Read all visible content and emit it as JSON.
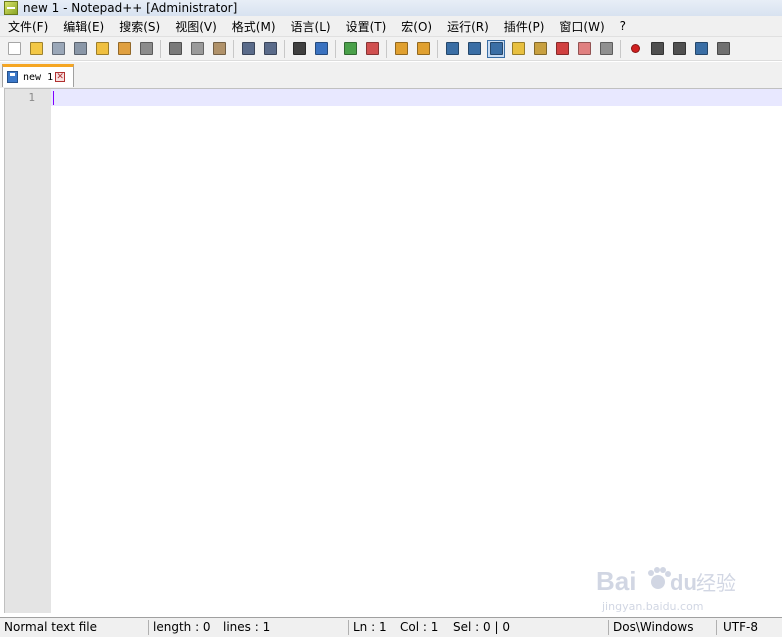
{
  "window": {
    "title": "new 1 - Notepad++ [Administrator]"
  },
  "menu": [
    "文件(F)",
    "编辑(E)",
    "搜索(S)",
    "视图(V)",
    "格式(M)",
    "语言(L)",
    "设置(T)",
    "宏(O)",
    "运行(R)",
    "插件(P)",
    "窗口(W)",
    "?"
  ],
  "toolbar": {
    "buttons": [
      {
        "icon": "new-file-icon",
        "color": "#ffffff"
      },
      {
        "icon": "open-file-icon",
        "color": "#f3c846"
      },
      {
        "icon": "save-icon",
        "color": "#9aa7b8"
      },
      {
        "icon": "save-all-icon",
        "color": "#8a97a8"
      },
      {
        "icon": "close-file-icon",
        "color": "#f0c040"
      },
      {
        "icon": "close-all-icon",
        "color": "#e0a040"
      },
      {
        "icon": "print-icon",
        "color": "#8c8c8c"
      },
      {
        "icon": "cut-icon",
        "color": "#7a7a7a"
      },
      {
        "icon": "copy-icon",
        "color": "#9a9a9a"
      },
      {
        "icon": "paste-icon",
        "color": "#b0926a"
      },
      {
        "icon": "undo-icon",
        "color": "#5a6b8a"
      },
      {
        "icon": "redo-icon",
        "color": "#5a6b8a"
      },
      {
        "icon": "find-icon",
        "color": "#404040"
      },
      {
        "icon": "replace-icon",
        "color": "#3a72c0"
      },
      {
        "icon": "zoom-in-icon",
        "color": "#4aa04a"
      },
      {
        "icon": "zoom-out-icon",
        "color": "#d05050"
      },
      {
        "icon": "sync-vertical-icon",
        "color": "#e0a030"
      },
      {
        "icon": "sync-horizontal-icon",
        "color": "#e0a030"
      },
      {
        "icon": "word-wrap-icon",
        "color": "#3a6ea5"
      },
      {
        "icon": "show-all-chars-icon",
        "color": "#3a6ea5"
      },
      {
        "icon": "indent-guide-icon",
        "color": "#3a6ea5"
      },
      {
        "icon": "user-language-icon",
        "color": "#e8c040"
      },
      {
        "icon": "document-map-icon",
        "color": "#c8a040"
      },
      {
        "icon": "function-list-icon",
        "color": "#d04040"
      },
      {
        "icon": "folder-workspace-icon",
        "color": "#e08080"
      },
      {
        "icon": "monitoring-icon",
        "color": "#909090"
      },
      {
        "icon": "record-macro-icon",
        "color": "#d02020"
      },
      {
        "icon": "stop-record-icon",
        "color": "#505050"
      },
      {
        "icon": "play-macro-icon",
        "color": "#505050"
      },
      {
        "icon": "play-multiple-icon",
        "color": "#3a6ea5"
      },
      {
        "icon": "save-macro-icon",
        "color": "#707070"
      }
    ],
    "separators_after": [
      6,
      9,
      11,
      13,
      15,
      17,
      25
    ]
  },
  "tabs": [
    {
      "label": "new 1"
    }
  ],
  "editor": {
    "line_numbers": [
      "1"
    ],
    "content": ""
  },
  "status": {
    "file_type": "Normal text file",
    "length": "length : 0",
    "lines": "lines : 1",
    "ln": "Ln : 1",
    "col": "Col : 1",
    "sel": "Sel : 0 | 0",
    "eol": "Dos\\Windows",
    "encoding": "UTF-8"
  },
  "watermark": {
    "brand": "Bai",
    "brand2": "du",
    "suffix": "经验",
    "url": "jingyan.baidu.com"
  }
}
